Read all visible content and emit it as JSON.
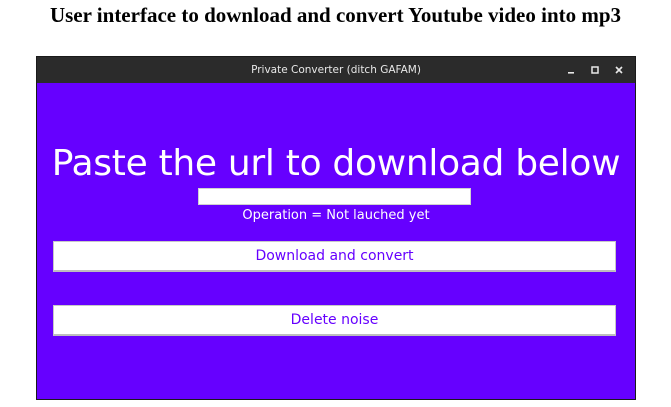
{
  "caption": "User interface to download and convert Youtube video into mp3",
  "window": {
    "title": "Private Converter (ditch GAFAM)",
    "controls": {
      "minimize_icon": "minimize-icon",
      "maximize_icon": "maximize-icon",
      "close_icon": "close-icon"
    }
  },
  "main": {
    "headline": "Paste the url to download below",
    "url_input": {
      "value": "",
      "placeholder": ""
    },
    "status": "Operation = Not lauched yet",
    "download_button": "Download and convert",
    "delete_button": "Delete noise"
  },
  "colors": {
    "background": "#6600ff",
    "button_text": "#6600ff",
    "titlebar": "#2b2b2b"
  }
}
